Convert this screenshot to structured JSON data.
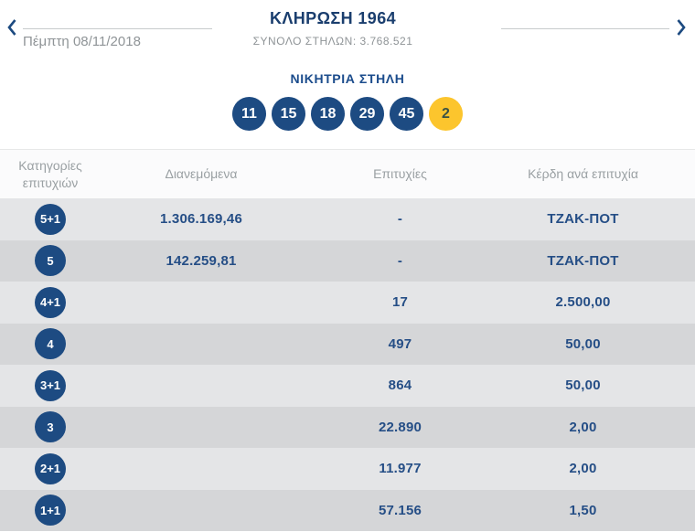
{
  "colors": {
    "navy_ball": "#1d4b82",
    "navy_text": "#254e86",
    "title_navy": "#1a3e6e",
    "heading_blue": "#1b4c8c",
    "bonus_yellow": "#fcc52d",
    "row_light": "#e4e5e7",
    "row_dark": "#d5d6d8",
    "muted_gray": "#8f9497",
    "header_gray": "#9aa0a3"
  },
  "nav": {
    "prev_icon": "chevron-left",
    "next_icon": "chevron-right",
    "date_label": "Πέμπτη 08/11/2018",
    "title": "ΚΛΗΡΩΣΗ 1964",
    "subtitle": "ΣΥΝΟΛΟ ΣΤΗΛΩΝ: 3.768.521"
  },
  "winning_column": {
    "heading": "ΝΙΚΗΤΡΙΑ ΣΤΗΛΗ",
    "numbers": [
      "11",
      "15",
      "18",
      "29",
      "45"
    ],
    "bonus_number": "2"
  },
  "results_table": {
    "headers": {
      "col1_line1": "Κατηγορίες",
      "col1_line2": "επιτυχιών",
      "col2": "Διανεμόμενα",
      "col3": "Επιτυχίες",
      "col4": "Κέρδη ανά επιτυχία"
    },
    "rows": [
      {
        "category": "5+1",
        "distributed": "1.306.169,46",
        "winners": "-",
        "prize": "ΤΖΑΚ-ΠΟΤ"
      },
      {
        "category": "5",
        "distributed": "142.259,81",
        "winners": "-",
        "prize": "ΤΖΑΚ-ΠΟΤ"
      },
      {
        "category": "4+1",
        "distributed": "",
        "winners": "17",
        "prize": "2.500,00"
      },
      {
        "category": "4",
        "distributed": "",
        "winners": "497",
        "prize": "50,00"
      },
      {
        "category": "3+1",
        "distributed": "",
        "winners": "864",
        "prize": "50,00"
      },
      {
        "category": "3",
        "distributed": "",
        "winners": "22.890",
        "prize": "2,00"
      },
      {
        "category": "2+1",
        "distributed": "",
        "winners": "11.977",
        "prize": "2,00"
      },
      {
        "category": "1+1",
        "distributed": "",
        "winners": "57.156",
        "prize": "1,50"
      }
    ]
  }
}
